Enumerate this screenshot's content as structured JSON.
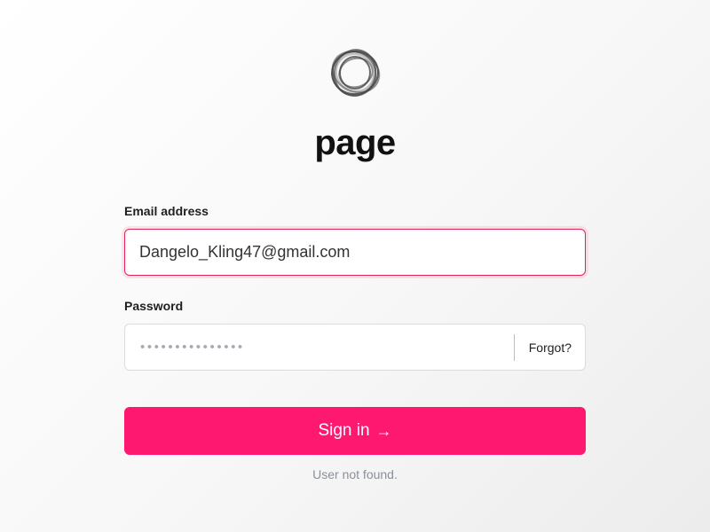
{
  "brand": {
    "logo_icon": "ring-logo-icon",
    "name": "page"
  },
  "form": {
    "email": {
      "label": "Email address",
      "value": "Dangelo_Kling47@gmail.com",
      "border_color": "#e0264f"
    },
    "password": {
      "label": "Password",
      "masked_value": "•••••••••••••••",
      "forgot_label": "Forgot?"
    },
    "submit": {
      "label": "Sign in",
      "icon": "arrow-right-icon",
      "arrow_glyph": "→",
      "color": "#ff1870"
    },
    "status_message": "User not found."
  }
}
